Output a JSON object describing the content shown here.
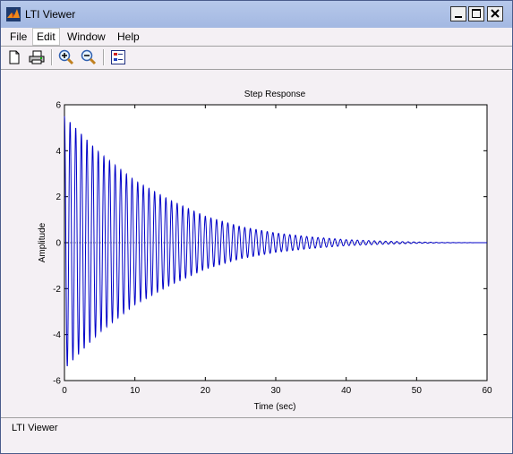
{
  "window": {
    "title": "LTI Viewer"
  },
  "menu": {
    "items": [
      "File",
      "Edit",
      "Window",
      "Help"
    ]
  },
  "toolbar": {
    "tools": [
      "new-file-icon",
      "print-icon",
      "zoom-in-icon",
      "zoom-out-icon",
      "plot-configuration-icon"
    ]
  },
  "status": {
    "text": "LTI Viewer"
  },
  "colors": {
    "titlebar": "#a9bde6",
    "response_line": "#0000c8",
    "window_bg": "#f4f0f4"
  },
  "chart_data": {
    "type": "line",
    "title": "Step Response",
    "xlabel": "Time (sec)",
    "ylabel": "Amplitude",
    "xlim": [
      0,
      60
    ],
    "ylim": [
      -6,
      6
    ],
    "xticks": [
      0,
      10,
      20,
      30,
      40,
      50,
      60
    ],
    "yticks": [
      -6,
      -4,
      -2,
      0,
      2,
      4,
      6
    ],
    "grid": false,
    "series": [
      {
        "oscillation_period_sec": 0.8,
        "envelope": {
          "x": [
            0,
            5,
            10,
            15,
            20,
            25,
            30,
            35,
            40,
            45,
            50,
            53.5,
            60
          ],
          "y": [
            5.5,
            3.9,
            2.7,
            1.85,
            1.15,
            0.7,
            0.42,
            0.25,
            0.13,
            0.07,
            0.03,
            0.01,
            0
          ]
        }
      }
    ]
  }
}
